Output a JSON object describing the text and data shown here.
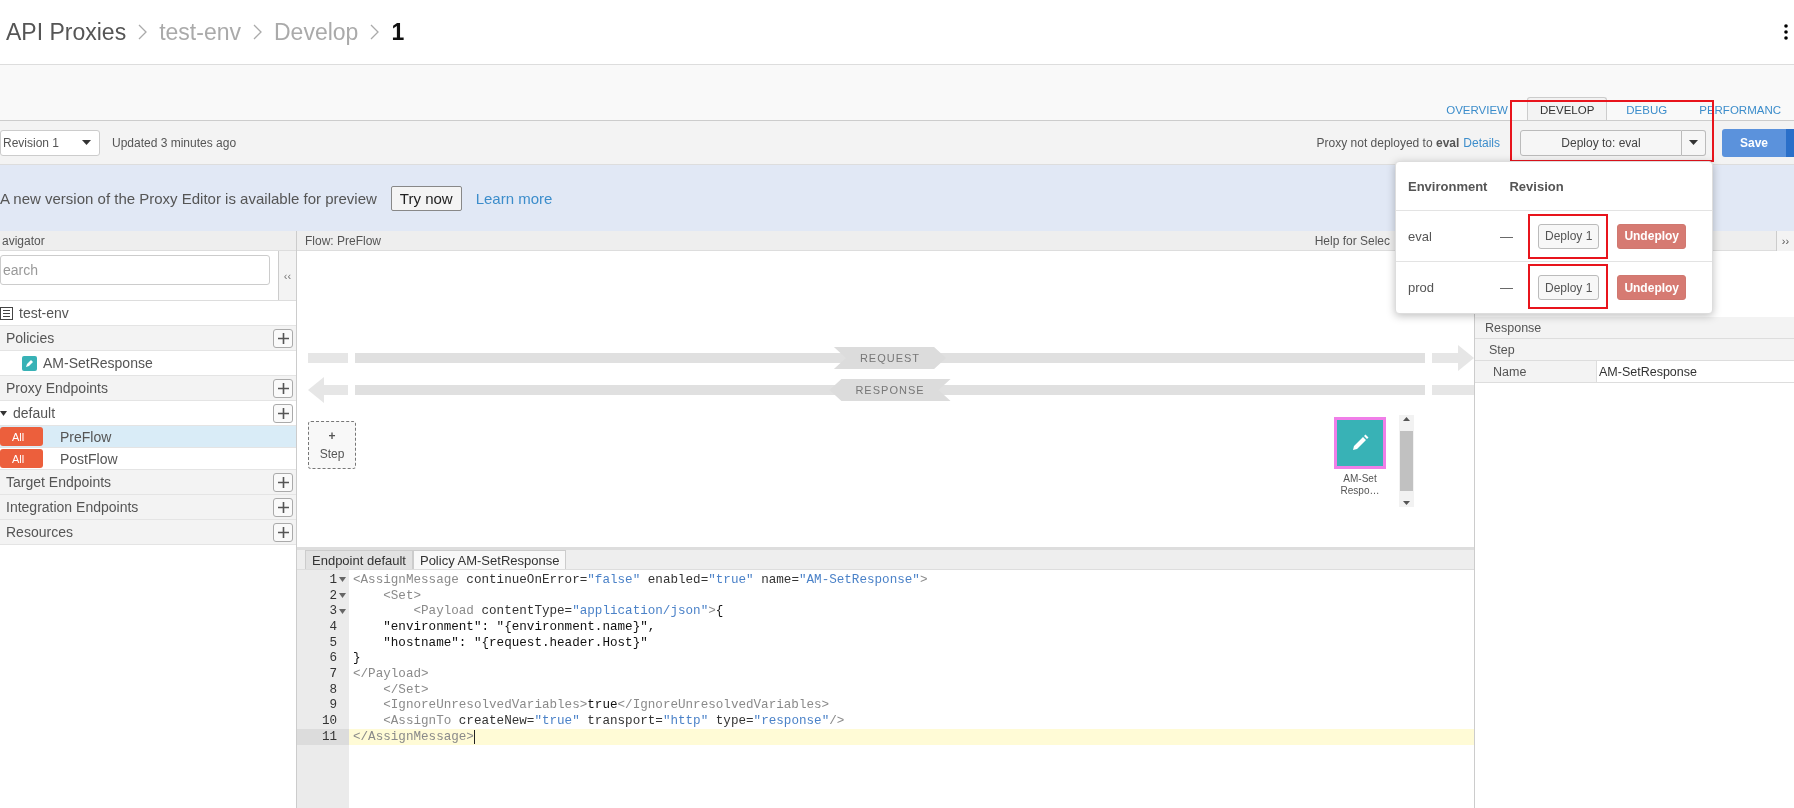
{
  "breadcrumb": [
    {
      "label": "API Proxies",
      "kind": "root"
    },
    {
      "label": "test-env",
      "kind": "link"
    },
    {
      "label": "Develop",
      "kind": "link"
    },
    {
      "label": "1",
      "kind": "current"
    }
  ],
  "tabs": [
    {
      "label": "OVERVIEW",
      "selected": false
    },
    {
      "label": "DEVELOP",
      "selected": true
    },
    {
      "label": "DEBUG",
      "selected": false
    },
    {
      "label": "PERFORMANC",
      "selected": false
    }
  ],
  "toolbar": {
    "revision": "Revision 1",
    "updated": "Updated 3 minutes ago",
    "status": "Proxy not deployed to **eval**",
    "details": "Details",
    "deploy": {
      "label": "Deploy to: eval",
      "highlighted": true
    },
    "save": "Save"
  },
  "banner": {
    "text": "A new version of the Proxy Editor is available for preview",
    "try": "Try now",
    "learn": "Learn more"
  },
  "navigator": {
    "title": "avigator",
    "collapse": "‹‹",
    "search": {
      "placeholder": "earch"
    },
    "items": [
      {
        "kind": "environment",
        "label": "test-env"
      },
      {
        "kind": "section",
        "label": "Policies",
        "children": [
          {
            "kind": "policy",
            "label": "AM-SetResponse"
          }
        ]
      },
      {
        "kind": "section",
        "label": "Proxy Endpoints",
        "children": [
          {
            "kind": "endpoint",
            "label": "default",
            "expanded": true,
            "children": [
              {
                "kind": "flow",
                "badge": "All",
                "label": "PreFlow",
                "selected": true
              },
              {
                "kind": "flow",
                "badge": "All",
                "label": "PostFlow",
                "selected": false
              }
            ]
          }
        ]
      },
      {
        "kind": "section",
        "label": "Target Endpoints"
      },
      {
        "kind": "section",
        "label": "Integration Endpoints"
      },
      {
        "kind": "section",
        "label": "Resources"
      }
    ]
  },
  "flow": {
    "title": "Flow: PreFlow",
    "help": "Help for Selec",
    "request": "REQUEST",
    "response": "RESPONSE",
    "step": {
      "plus": "+",
      "label": "Step"
    },
    "policy": {
      "lines": [
        "AM-Set",
        "Respo…"
      ],
      "selected": true
    }
  },
  "editor": {
    "tabs": [
      {
        "label": "Endpoint default",
        "selected": false
      },
      {
        "label": "Policy AM-SetResponse",
        "selected": true
      }
    ],
    "lines": [
      {
        "number": "1",
        "fold": true,
        "active": false,
        "segments": [
          {
            "kind": "tag",
            "text": "<AssignMessage"
          },
          {
            "kind": "attr",
            "text": " continueOnError="
          },
          {
            "kind": "value",
            "text": "\"false\""
          },
          {
            "kind": "attr",
            "text": " enabled="
          },
          {
            "kind": "value",
            "text": "\"true\""
          },
          {
            "kind": "attr",
            "text": " name="
          },
          {
            "kind": "value",
            "text": "\"AM-SetResponse\""
          },
          {
            "kind": "tag",
            "text": ">"
          }
        ]
      },
      {
        "number": "2",
        "fold": true,
        "active": false,
        "segments": [
          {
            "kind": "tag",
            "text": "    <Set>"
          }
        ]
      },
      {
        "number": "3",
        "fold": true,
        "active": false,
        "segments": [
          {
            "kind": "tag",
            "text": "        <Payload"
          },
          {
            "kind": "attr",
            "text": " contentType="
          },
          {
            "kind": "value",
            "text": "\"application/json\""
          },
          {
            "kind": "tag",
            "text": ">"
          },
          {
            "kind": "text",
            "text": "{"
          }
        ]
      },
      {
        "number": "4",
        "fold": false,
        "active": false,
        "segments": [
          {
            "kind": "text",
            "text": "    \"environment\": \"{environment.name}\","
          }
        ]
      },
      {
        "number": "5",
        "fold": false,
        "active": false,
        "segments": [
          {
            "kind": "text",
            "text": "    \"hostname\": \"{request.header.Host}\""
          }
        ]
      },
      {
        "number": "6",
        "fold": false,
        "active": false,
        "segments": [
          {
            "kind": "text",
            "text": "}"
          }
        ]
      },
      {
        "number": "7",
        "fold": false,
        "active": false,
        "segments": [
          {
            "kind": "tag",
            "text": "</Payload>"
          }
        ]
      },
      {
        "number": "8",
        "fold": false,
        "active": false,
        "segments": [
          {
            "kind": "tag",
            "text": "    </Set>"
          }
        ]
      },
      {
        "number": "9",
        "fold": false,
        "active": false,
        "segments": [
          {
            "kind": "tag",
            "text": "    <IgnoreUnresolvedVariables>"
          },
          {
            "kind": "text",
            "text": "true"
          },
          {
            "kind": "tag",
            "text": "</IgnoreUnresolvedVariables>"
          }
        ]
      },
      {
        "number": "10",
        "fold": false,
        "active": false,
        "segments": [
          {
            "kind": "tag",
            "text": "    <AssignTo"
          },
          {
            "kind": "attr",
            "text": " createNew="
          },
          {
            "kind": "value",
            "text": "\"true\""
          },
          {
            "kind": "attr",
            "text": " transport="
          },
          {
            "kind": "value",
            "text": "\"http\""
          },
          {
            "kind": "attr",
            "text": " type="
          },
          {
            "kind": "value",
            "text": "\"response\""
          },
          {
            "kind": "tag",
            "text": "/>"
          }
        ]
      },
      {
        "number": "11",
        "fold": false,
        "active": true,
        "segments": [
          {
            "kind": "tag",
            "text": "</AssignMessage>"
          }
        ]
      }
    ]
  },
  "properties": {
    "expand": "››",
    "rows": [
      {
        "kind": "header",
        "label": "Response"
      },
      {
        "kind": "subheader",
        "label": "Step"
      },
      {
        "kind": "property",
        "label": "Name",
        "value": "AM-SetResponse"
      }
    ]
  },
  "deploy_menu": {
    "columns": [
      "Environment",
      "Revision"
    ],
    "rows": [
      {
        "environment": "eval",
        "revision": "—",
        "deploy": "Deploy 1",
        "undeploy": "Undeploy",
        "highlighted": true
      },
      {
        "environment": "prod",
        "revision": "—",
        "deploy": "Deploy 1",
        "undeploy": "Undeploy",
        "highlighted": true
      }
    ]
  }
}
